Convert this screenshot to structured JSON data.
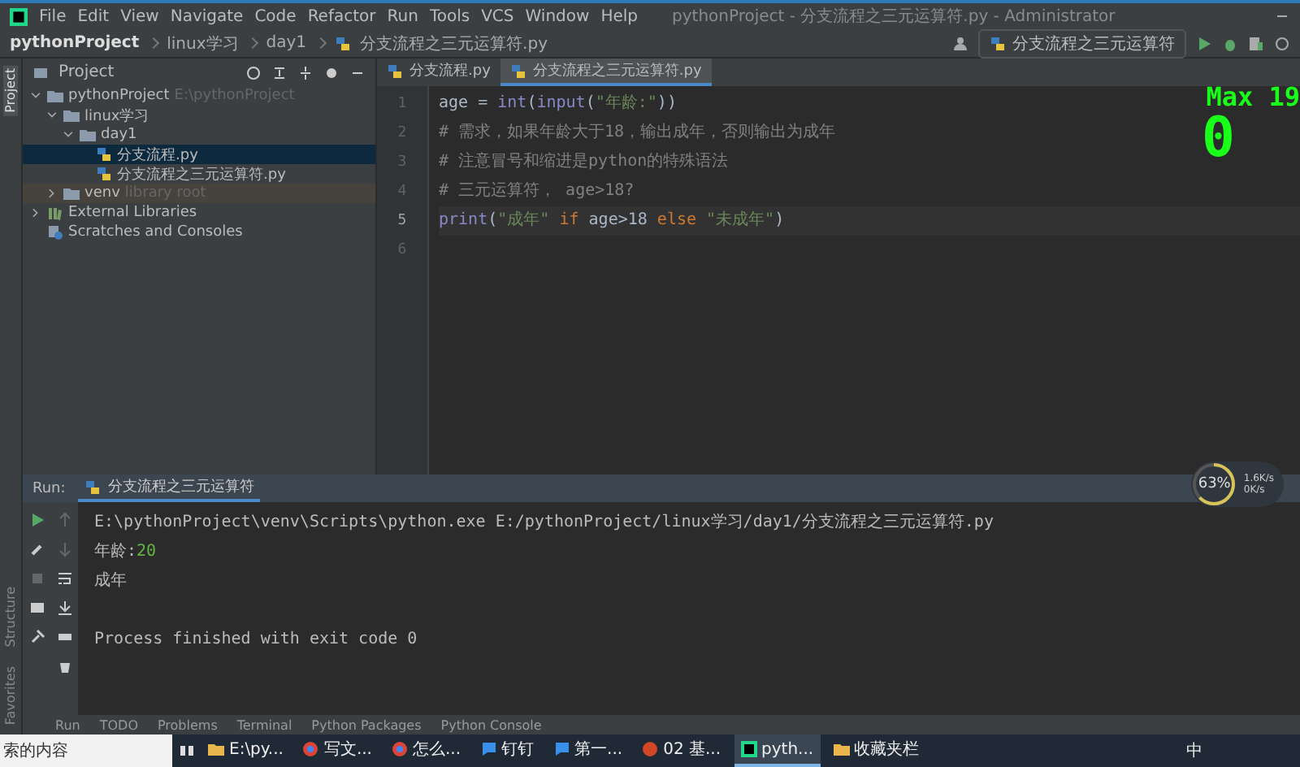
{
  "window": {
    "title": "pythonProject - 分支流程之三元运算符.py - Administrator"
  },
  "menu": [
    "File",
    "Edit",
    "View",
    "Navigate",
    "Code",
    "Refactor",
    "Run",
    "Tools",
    "VCS",
    "Window",
    "Help"
  ],
  "breadcrumb": [
    "pythonProject",
    "linux学习",
    "day1",
    "分支流程之三元运算符.py"
  ],
  "run_config": {
    "label": "分支流程之三元运算符"
  },
  "side_strip": {
    "top": "Project",
    "bottom": [
      "Structure",
      "Favorites"
    ]
  },
  "project_panel": {
    "title": "Project",
    "tree": [
      {
        "label": "pythonProject",
        "note": "E:\\pythonProject",
        "kind": "folder",
        "expanded": true,
        "selected": false,
        "children": [
          {
            "label": "linux学习",
            "kind": "folder",
            "expanded": true,
            "selected": false,
            "children": [
              {
                "label": "day1",
                "kind": "folder",
                "expanded": true,
                "selected": false,
                "children": [
                  {
                    "label": "分支流程.py",
                    "kind": "file",
                    "selected": true
                  },
                  {
                    "label": "分支流程之三元运算符.py",
                    "kind": "file",
                    "selected": false
                  }
                ]
              }
            ]
          },
          {
            "label": "venv",
            "note": "library root",
            "kind": "folder",
            "expanded": false,
            "selected": false
          }
        ]
      },
      {
        "label": "External Libraries",
        "kind": "library",
        "expanded": false,
        "selected": false
      },
      {
        "label": "Scratches and Consoles",
        "kind": "scratch",
        "selected": false
      }
    ]
  },
  "editor_tabs": [
    {
      "label": "分支流程.py",
      "selected": false
    },
    {
      "label": "分支流程之三元运算符.py",
      "selected": true
    }
  ],
  "code_lines": [
    {
      "number": "1",
      "tokens": [
        {
          "kind": "plain",
          "text": "age = "
        },
        {
          "kind": "func",
          "text": "int"
        },
        {
          "kind": "plain",
          "text": "("
        },
        {
          "kind": "func",
          "text": "input"
        },
        {
          "kind": "plain",
          "text": "("
        },
        {
          "kind": "string",
          "text": "\"年龄:\""
        },
        {
          "kind": "plain",
          "text": "))"
        }
      ]
    },
    {
      "number": "2",
      "tokens": [
        {
          "kind": "comment",
          "text": "# 需求，如果年龄大于18，输出成年，否则输出为成年"
        }
      ]
    },
    {
      "number": "3",
      "tokens": [
        {
          "kind": "comment",
          "text": "# 注意冒号和缩进是python的特殊语法"
        }
      ]
    },
    {
      "number": "4",
      "tokens": [
        {
          "kind": "comment",
          "text": "# 三元运算符， age>18?"
        }
      ]
    },
    {
      "number": "5",
      "tokens": [
        {
          "kind": "func",
          "text": "print"
        },
        {
          "kind": "plain",
          "text": "("
        },
        {
          "kind": "string",
          "text": "\"成年\""
        },
        {
          "kind": "keyword",
          "text": " if "
        },
        {
          "kind": "plain",
          "text": "age>18"
        },
        {
          "kind": "keyword",
          "text": " else "
        },
        {
          "kind": "string",
          "text": "\"未成年\""
        },
        {
          "kind": "plain",
          "text": ")"
        }
      ]
    },
    {
      "number": "6"
    }
  ],
  "game_overlay": {
    "score_label": "Max 19",
    "score": "0"
  },
  "run_panel": {
    "label": "Run:",
    "tab": "分支流程之三元运算符",
    "output": [
      {
        "kind": "command",
        "text": "E:\\pythonProject\\venv\\Scripts\\python.exe E:/pythonProject/linux学习/day1/分支流程之三元运算符.py"
      },
      {
        "kind": "prompt",
        "text": "年龄:",
        "input": "20"
      },
      {
        "kind": "plain",
        "text": "成年"
      },
      {
        "kind": "blank"
      },
      {
        "kind": "plain",
        "text": "Process finished with exit code 0"
      }
    ]
  },
  "net_widget": {
    "percent": "63%",
    "level": 0.63,
    "up": "1.6K/s",
    "down": "0K/s"
  },
  "tool_tabs": [
    "Run",
    "TODO",
    "Problems",
    "Terminal",
    "Python Packages",
    "Python Console"
  ],
  "taskbar": {
    "search": "索的内容",
    "apps": [
      {
        "label": "E:\\py...",
        "kind": "folder",
        "active": false
      },
      {
        "label": "写文...",
        "kind": "browser",
        "active": false
      },
      {
        "label": "怎么...",
        "kind": "browser",
        "active": false
      },
      {
        "label": "钉钉",
        "kind": "chat",
        "active": false
      },
      {
        "label": "第一...",
        "kind": "chat",
        "active": false
      },
      {
        "label": "02 基...",
        "kind": "slides",
        "active": false
      },
      {
        "label": "pyth...",
        "kind": "ide",
        "active": true
      },
      {
        "label": "收藏夹栏",
        "kind": "folder",
        "active": false
      }
    ],
    "ime": "中"
  }
}
